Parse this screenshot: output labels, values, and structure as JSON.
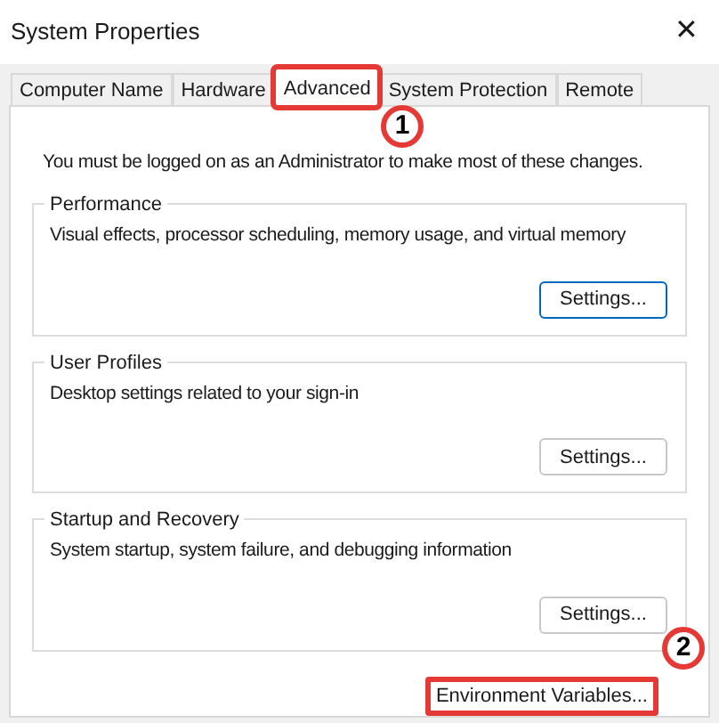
{
  "window": {
    "title": "System Properties",
    "close": "✕"
  },
  "tabs": [
    {
      "label": "Computer Name",
      "selected": false,
      "highlighted": false
    },
    {
      "label": "Hardware",
      "selected": false,
      "highlighted": false
    },
    {
      "label": "Advanced",
      "selected": true,
      "highlighted": true
    },
    {
      "label": "System Protection",
      "selected": false,
      "highlighted": false
    },
    {
      "label": "Remote",
      "selected": false,
      "highlighted": false
    }
  ],
  "notice": "You must be logged on as an Administrator to make most of these changes.",
  "groups": [
    {
      "title": "Performance",
      "description": "Visual effects, processor scheduling, memory usage, and virtual memory",
      "button": "Settings...",
      "default": true
    },
    {
      "title": "User Profiles",
      "description": "Desktop settings related to your sign-in",
      "button": "Settings...",
      "default": false
    },
    {
      "title": "Startup and Recovery",
      "description": "System startup, system failure, and debugging information",
      "button": "Settings...",
      "default": false
    }
  ],
  "env_button": {
    "label": "Environment Variables...",
    "highlighted": true
  },
  "step_badges": [
    "1",
    "2"
  ]
}
